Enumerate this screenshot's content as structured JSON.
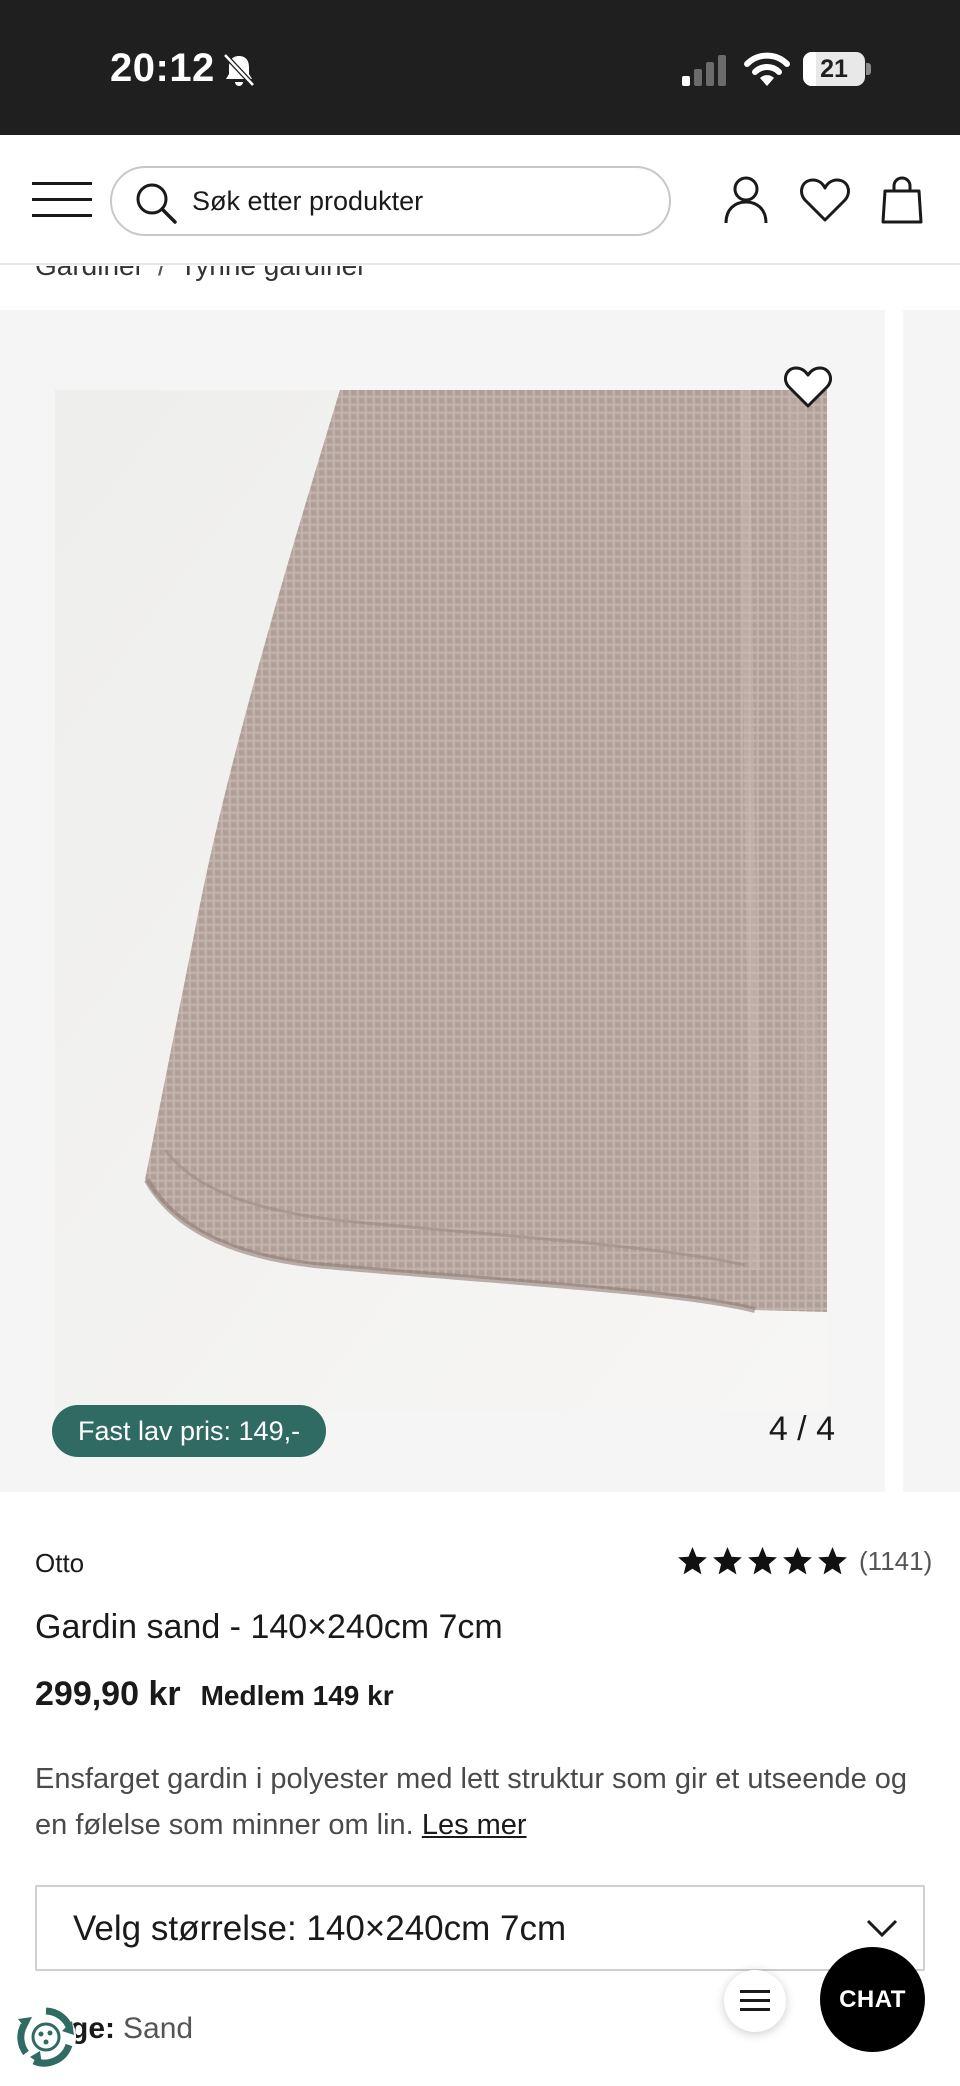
{
  "status_bar": {
    "time": "20:12",
    "battery_level": "21",
    "battery_fraction": 0.21
  },
  "header": {
    "search": {
      "placeholder": "Søk etter produkter"
    }
  },
  "breadcrumb": [
    "Gardiner",
    "Tynne gardiner"
  ],
  "gallery": {
    "badge": "Fast lav pris: 149,-",
    "counter": "4 / 4"
  },
  "product": {
    "brand": "Otto",
    "rating": {
      "stars": 5,
      "count": "(1141)"
    },
    "title": "Gardin sand - 140×240cm 7cm",
    "price": "299,90 kr",
    "member_price": "Medlem 149 kr",
    "description": "Ensfarget gardin i polyester med lett struktur som gir et utseende og en følelse som minner om lin.",
    "read_more": "Les mer"
  },
  "size_select": {
    "label": "Velg størrelse: 140×240cm 7cm"
  },
  "color": {
    "key": "ge:",
    "value": "Sand"
  },
  "chat": {
    "label": "CHAT"
  },
  "colors": {
    "accent": "#2f6b62",
    "fabric": "#b6a59e",
    "chat_bg": "#000000"
  },
  "icons": [
    "bell-slash-icon",
    "signal-icon",
    "wifi-icon",
    "battery-icon",
    "menu-icon",
    "search-icon",
    "account-icon",
    "wishlist-icon",
    "bag-icon",
    "heart-icon",
    "star-icon",
    "chevron-down-icon",
    "recycle-icon"
  ]
}
